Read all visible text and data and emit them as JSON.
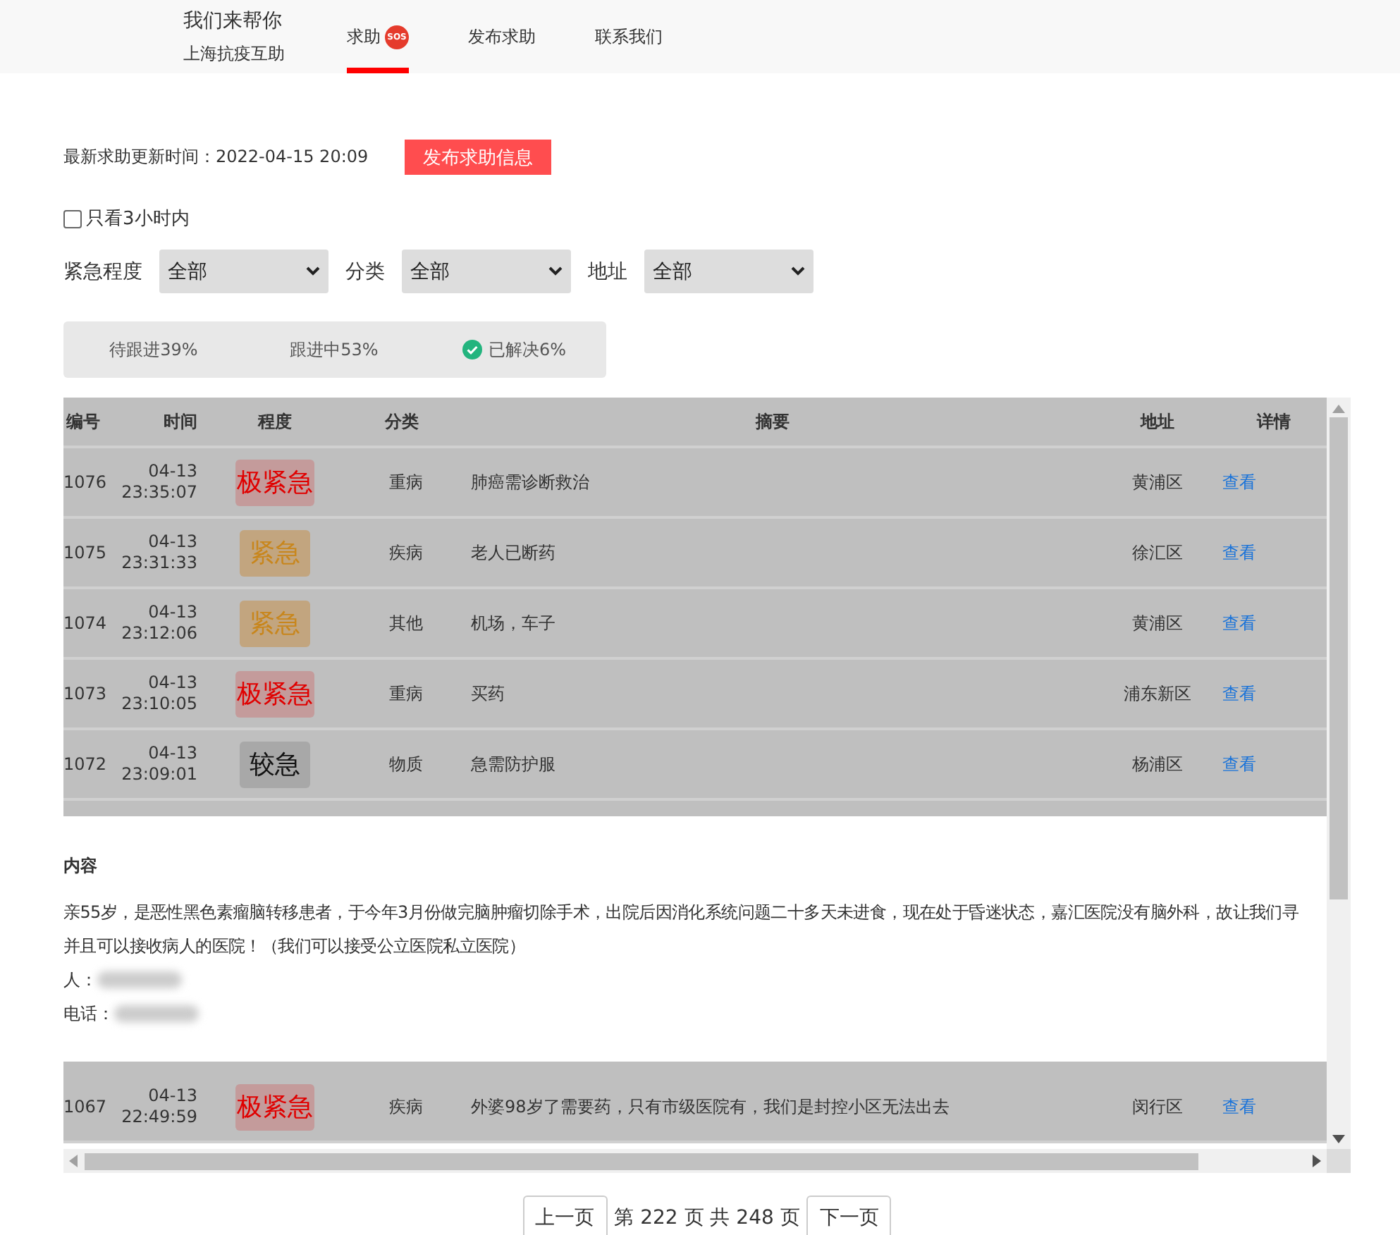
{
  "nav": {
    "brand": {
      "title": "我们来帮你",
      "subtitle": "上海抗疫互助"
    },
    "tabs": [
      {
        "label": "求助",
        "badge": "SOS",
        "selected": true
      },
      {
        "label": "发布求助",
        "selected": false
      },
      {
        "label": "联系我们",
        "selected": false
      }
    ]
  },
  "update": {
    "label": "最新求助更新时间：2022-04-15 20:09",
    "button": "发布求助信息"
  },
  "recent_filter": {
    "label": "只看3小时内",
    "checked": false
  },
  "filters": [
    {
      "label": "紧急程度",
      "value": "全部"
    },
    {
      "label": "分类",
      "value": "全部"
    },
    {
      "label": "地址",
      "value": "全部"
    }
  ],
  "stats": [
    {
      "label": "待跟进39%",
      "kind": "plain"
    },
    {
      "label": "跟进中53%",
      "kind": "plain"
    },
    {
      "label": "已解决6%",
      "kind": "resolved"
    }
  ],
  "table": {
    "columns": [
      "编号",
      "时间",
      "程度",
      "分类",
      "摘要",
      "地址",
      "详情"
    ],
    "rows_above": [
      {
        "id": "1076",
        "date": "04-13",
        "time": "23:35:07",
        "level": {
          "text": "极紧急",
          "kind": "critical"
        },
        "category": "重病",
        "summary": "肺癌需诊断救治",
        "address": "黄浦区",
        "action": "查看"
      },
      {
        "id": "1075",
        "date": "04-13",
        "time": "23:31:33",
        "level": {
          "text": "紧急",
          "kind": "urgent"
        },
        "category": "疾病",
        "summary": "老人已断药",
        "address": "徐汇区",
        "action": "查看"
      },
      {
        "id": "1074",
        "date": "04-13",
        "time": "23:12:06",
        "level": {
          "text": "紧急",
          "kind": "urgent"
        },
        "category": "其他",
        "summary": "机场，车子",
        "address": "黄浦区",
        "action": "查看"
      },
      {
        "id": "1073",
        "date": "04-13",
        "time": "23:10:05",
        "level": {
          "text": "极紧急",
          "kind": "critical"
        },
        "category": "重病",
        "summary": "买药",
        "address": "浦东新区",
        "action": "查看"
      },
      {
        "id": "1072",
        "date": "04-13",
        "time": "23:09:01",
        "level": {
          "text": "较急",
          "kind": "moderate"
        },
        "category": "物质",
        "summary": "急需防护服",
        "address": "杨浦区",
        "action": "查看"
      }
    ],
    "detail": {
      "heading": "内容",
      "lines": [
        "亲55岁，是恶性黑色素瘤脑转移患者，于今年3月份做完脑肿瘤切除手术，出院后因消化系统问题二十多天未进食，现在处于昏迷状态，嘉汇医院没有脑外科，故让我们寻",
        "并且可以接收病人的医院！（我们可以接受公立医院私立医院）"
      ],
      "contacts": [
        {
          "label": "人："
        },
        {
          "label": "电话："
        }
      ]
    },
    "rows_below": [
      {
        "id": "1067",
        "date": "04-13",
        "time": "22:49:59",
        "level": {
          "text": "极紧急",
          "kind": "critical"
        },
        "category": "疾病",
        "summary": "外婆98岁了需要药，只有市级医院有，我们是封控小区无法出去",
        "address": "闵行区",
        "action": "查看"
      }
    ]
  },
  "pagination": {
    "prev": "上一页",
    "info": "第 222 页 共 248 页",
    "next": "下一页"
  }
}
